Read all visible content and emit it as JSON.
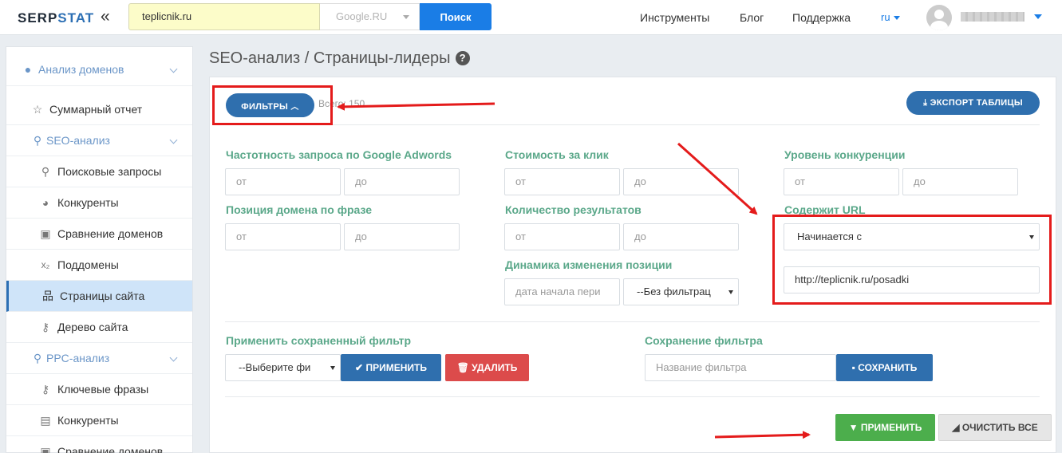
{
  "header": {
    "logo_main": "SERP",
    "logo_accent": "STAT",
    "collapse_icon": "«",
    "search_value": "teplicnik.ru",
    "region": "Google.RU",
    "search_button": "Поиск",
    "nav": [
      "Инструменты",
      "Блог",
      "Поддержка"
    ],
    "language": "ru"
  },
  "sidebar": {
    "items": [
      {
        "label": "Анализ доменов",
        "icon": "globe-icon"
      },
      {
        "label": "Суммарный отчет",
        "icon": "star-icon"
      },
      {
        "label": "SEO-анализ",
        "icon": "search-icon"
      },
      {
        "label": "Поисковые запросы",
        "icon": "search-icon"
      },
      {
        "label": "Конкуренты",
        "icon": "pie-chart-icon"
      },
      {
        "label": "Сравнение доменов",
        "icon": "cubes-icon"
      },
      {
        "label": "Поддомены",
        "icon": "subscript-icon"
      },
      {
        "label": "Страницы сайта",
        "icon": "sitemap-icon"
      },
      {
        "label": "Дерево сайта",
        "icon": "key-icon"
      },
      {
        "label": "PPC-анализ",
        "icon": "search-icon"
      },
      {
        "label": "Ключевые фразы",
        "icon": "key-icon"
      },
      {
        "label": "Конкуренты",
        "icon": "money-icon"
      },
      {
        "label": "Сравнение доменов",
        "icon": "cubes-icon"
      }
    ]
  },
  "page": {
    "title": "SEO-анализ / Страницы-лидеры",
    "help_icon": "?"
  },
  "toolbar": {
    "filters_button": "ФИЛЬТРЫ",
    "total": "Всего: 150",
    "export_button": "ЭКСПОРТ ТАБЛИЦЫ"
  },
  "filters": {
    "adwords_label": "Частотность запроса по Google Adwords",
    "cpc_label": "Стоимость за клик",
    "competition_label": "Уровень конкуренции",
    "position_label": "Позиция домена по фразе",
    "results_label": "Количество результатов",
    "url_label": "Содержит URL",
    "dynamics_label": "Динамика изменения позиции",
    "from_placeholder": "от",
    "to_placeholder": "до",
    "url_mode": "Начинается с",
    "url_value": "http://teplicnik.ru/posadki",
    "date_placeholder": "дата начала пери",
    "dynamics_select": "--Без фильтрац"
  },
  "saved": {
    "apply_saved_label": "Применить сохраненный фильтр",
    "select_placeholder": "--Выберите фи",
    "apply_button": "ПРИМЕНИТЬ",
    "delete_button": "УДАЛИТЬ",
    "save_label": "Сохранение фильтра",
    "name_placeholder": "Название фильтра",
    "save_button": "СОХРАНИТЬ"
  },
  "actions": {
    "apply_button": "ПРИМЕНИТЬ",
    "clear_button": "ОЧИСТИТЬ ВСЕ"
  },
  "colors": {
    "accent": "#2f6fae",
    "label_green": "#5ba88a",
    "annotation_red": "#e41b1b"
  }
}
